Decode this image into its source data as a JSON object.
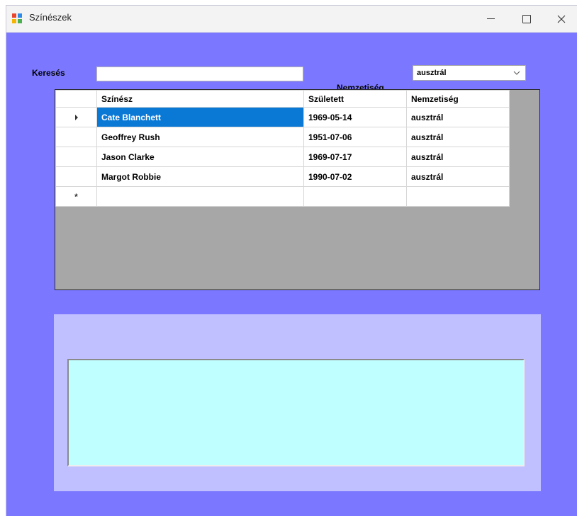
{
  "window": {
    "title": "Színészek",
    "background_color": "#7b78ff",
    "controls": {
      "minimize": "minimize-icon",
      "maximize": "maximize-icon",
      "close": "close-icon"
    }
  },
  "search": {
    "label": "Keresés",
    "value": ""
  },
  "nationality_filter": {
    "label": "Nemzetiség",
    "selected": "ausztrál"
  },
  "grid": {
    "columns": [
      "Színész",
      "Született",
      "Nemzetiség"
    ],
    "rows": [
      {
        "name": "Cate Blanchett",
        "born": "1969-05-14",
        "nationality": "ausztrál",
        "selected": true
      },
      {
        "name": "Geoffrey Rush",
        "born": "1951-07-06",
        "nationality": "ausztrál"
      },
      {
        "name": "Jason Clarke",
        "born": "1969-07-17",
        "nationality": "ausztrál"
      },
      {
        "name": "Margot Robbie",
        "born": "1990-07-02",
        "nationality": "ausztrál"
      }
    ],
    "selection_color": "#0a79d5"
  },
  "details": {
    "text": "",
    "background_color": "#c0ffff",
    "panel_color": "#c0bfff"
  }
}
